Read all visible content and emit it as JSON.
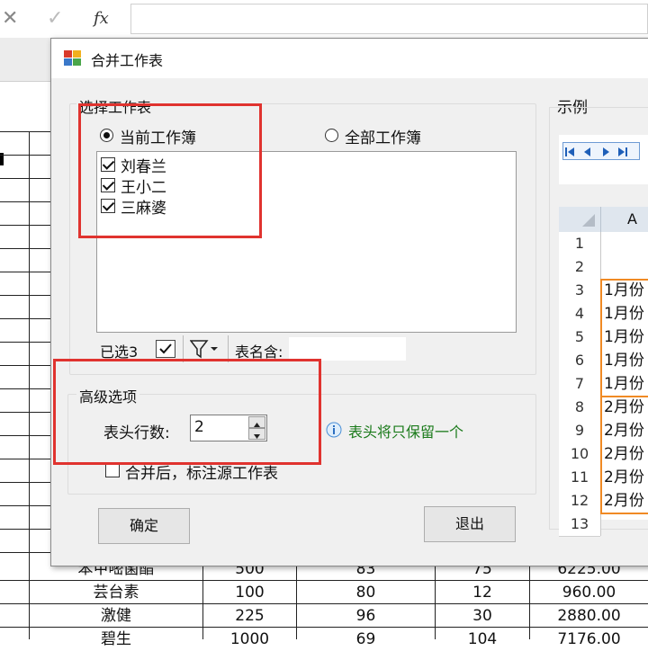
{
  "formula_bar": {
    "cancel_symbol": "✕",
    "confirm_symbol": "✓",
    "fx_label": "fx"
  },
  "sheet": {
    "rows": [
      {
        "name": "苯甲嘧菌酯",
        "c2": "500",
        "c3": "83",
        "c4": "75",
        "c5": "6225.00"
      },
      {
        "name": "芸台素",
        "c2": "100",
        "c3": "80",
        "c4": "12",
        "c5": "960.00"
      },
      {
        "name": "激健",
        "c2": "225",
        "c3": "96",
        "c4": "30",
        "c5": "2880.00"
      },
      {
        "name": "碧生",
        "c2": "1000",
        "c3": "69",
        "c4": "104",
        "c5": "7176.00"
      }
    ]
  },
  "dialog": {
    "title": "合并工作表",
    "select_group_label": "选择工作表",
    "radio_current": "当前工作簿",
    "radio_all": "全部工作簿",
    "sheets": [
      "刘春兰",
      "王小二",
      "三麻婆"
    ],
    "selected_count": "已选3",
    "name_contains_label": "表名含:",
    "advanced_group_label": "高级选项",
    "header_rows_label": "表头行数:",
    "header_rows_value": "2",
    "info_text": "表头将只保留一个",
    "mark_source_label": "合并后，标注源工作表",
    "ok_button": "确定",
    "exit_button": "退出",
    "example_label": "示例",
    "example_col_header": "A",
    "example_rows": [
      {
        "num": "1",
        "text": ""
      },
      {
        "num": "2",
        "text": ""
      },
      {
        "num": "3",
        "text": "1月份"
      },
      {
        "num": "4",
        "text": "1月份"
      },
      {
        "num": "5",
        "text": "1月份"
      },
      {
        "num": "6",
        "text": "1月份"
      },
      {
        "num": "7",
        "text": "1月份"
      },
      {
        "num": "8",
        "text": "2月份"
      },
      {
        "num": "9",
        "text": "2月份"
      },
      {
        "num": "10",
        "text": "2月份"
      },
      {
        "num": "11",
        "text": "2月份"
      },
      {
        "num": "12",
        "text": "2月份"
      },
      {
        "num": "13",
        "text": ""
      }
    ]
  },
  "colors": {
    "highlight_red": "#e0332f",
    "example_orange": "#f08a24",
    "info_green": "#1a7a1a"
  }
}
